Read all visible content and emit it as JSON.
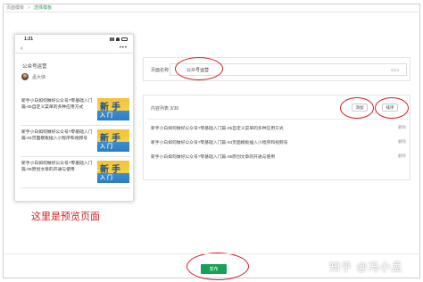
{
  "breadcrumb": {
    "parent": "页面模板",
    "current": "选择模板"
  },
  "phone": {
    "time": "1:21",
    "back_icon": "‹",
    "more_icon": "•••",
    "account_title": "公众号运营",
    "author_name": "孟大侠",
    "articles": [
      {
        "title": "新手小白如何做好公众号?零基础入门篇-05自定义菜单的多种应用方式",
        "thumb_big": "新手",
        "thumb_small": "入门"
      },
      {
        "title": "新手小白如何做好公众号?零基础入门篇-04页面模板插入小程序和视频号",
        "thumb_big": "新手",
        "thumb_small": "入门"
      },
      {
        "title": "新手小白如何做好公众号?零基础入门篇-06原创文章的开通与使用",
        "thumb_big": "新手",
        "thumb_small": "入门"
      }
    ]
  },
  "preview_label": "这里是预览页面",
  "name_card": {
    "label": "页面名称",
    "value": "公众号运营",
    "count": "5/24"
  },
  "list_card": {
    "label": "内容列表",
    "count": "3/30",
    "add_label": "添加",
    "sort_label": "排序",
    "rows": [
      {
        "title": "新手小白如何做好公众号?零基础入门篇-05自定义菜单的多种应用方式",
        "delete_label": "删除"
      },
      {
        "title": "新手小白如何做好公众号?零基础入门篇-04页面模板插入小程序和视频号",
        "delete_label": "删除"
      },
      {
        "title": "新手小白如何做好公众号?零基础入门篇-06原创文章的开通与使用",
        "delete_label": "删除"
      }
    ]
  },
  "publish_label": "发布",
  "watermark": "知乎 @冯小孟",
  "colors": {
    "accent": "#18a058",
    "highlight_red": "#d42020",
    "breadcrumb_active": "#3aa063"
  }
}
